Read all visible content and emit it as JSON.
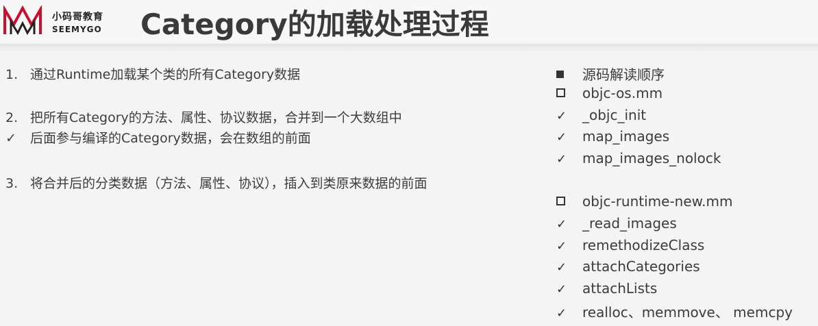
{
  "logo": {
    "cn": "小码哥教育",
    "en": "SEEMYGO",
    "brand_color": "#c8102e"
  },
  "title": "Category的加载处理过程",
  "left_items": [
    {
      "marker": "1.",
      "text": "通过Runtime加载某个类的所有Category数据"
    },
    {
      "marker": "2.",
      "text": "把所有Category的方法、属性、协议数据，合并到一个大数组中"
    },
    {
      "marker": "✓",
      "text": "后面参与编译的Category数据，会在数组的前面"
    },
    {
      "marker": "3.",
      "text": "将合并后的分类数据（方法、属性、协议），插入到类原来数据的前面"
    }
  ],
  "right_items": [
    {
      "marker": "filled-square",
      "text": "源码解读顺序"
    },
    {
      "marker": "open-square",
      "text": "objc-os.mm"
    },
    {
      "marker": "check",
      "text": "_objc_init"
    },
    {
      "marker": "check",
      "text": "map_images"
    },
    {
      "marker": "check",
      "text": "map_images_nolock"
    },
    {
      "marker": "open-square",
      "text": "objc-runtime-new.mm"
    },
    {
      "marker": "check",
      "text": "_read_images"
    },
    {
      "marker": "check",
      "text": "remethodizeClass"
    },
    {
      "marker": "check",
      "text": "attachCategories"
    },
    {
      "marker": "check",
      "text": "attachLists"
    },
    {
      "marker": "check",
      "text": "realloc、memmove、 memcpy"
    }
  ]
}
